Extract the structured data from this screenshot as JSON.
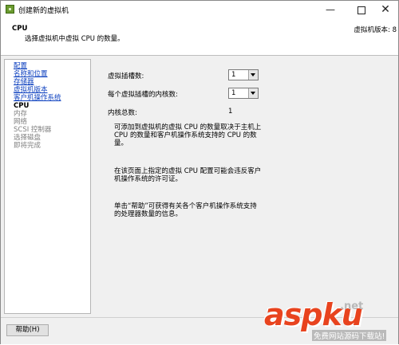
{
  "window": {
    "title": "创建新的虚拟机",
    "minimize_glyph": "—",
    "close_glyph": "✕"
  },
  "header": {
    "heading": "CPU",
    "description": "选择虚拟机中虚拟 CPU 的数量。",
    "vm_version": "虚拟机版本: 8"
  },
  "nav": {
    "items": [
      {
        "label": "配置",
        "state": "done"
      },
      {
        "label": "名称和位置",
        "state": "done"
      },
      {
        "label": "存储器",
        "state": "done"
      },
      {
        "label": "虚拟机版本",
        "state": "done"
      },
      {
        "label": "客户机操作系统",
        "state": "done"
      },
      {
        "label": "CPU",
        "state": "current"
      },
      {
        "label": "内存",
        "state": "pending"
      },
      {
        "label": "网络",
        "state": "pending"
      },
      {
        "label": "SCSI 控制器",
        "state": "pending"
      },
      {
        "label": "选择磁盘",
        "state": "pending"
      },
      {
        "label": "即将完成",
        "state": "pending"
      }
    ]
  },
  "form": {
    "sockets_label": "虚拟插槽数:",
    "sockets_value": "1",
    "cores_label": "每个虚拟插槽的内核数:",
    "cores_value": "1",
    "total_label": "内核总数:",
    "total_value": "1"
  },
  "info": {
    "p1": "可添加到虚拟机的虚拟 CPU 的数量取决于主机上 CPU 的数量和客户机操作系统支持的 CPU 的数量。",
    "p2": "在该页面上指定的虚拟 CPU 配置可能会违反客户机操作系统的许可证。",
    "p3": "单击“帮助”可获得有关各个客户机操作系统支持的处理器数量的信息。"
  },
  "footer": {
    "help_label": "帮助(H)"
  },
  "watermark": {
    "main": "aspku",
    "tld": ".net",
    "sub": "免费网站源码下载站!"
  }
}
